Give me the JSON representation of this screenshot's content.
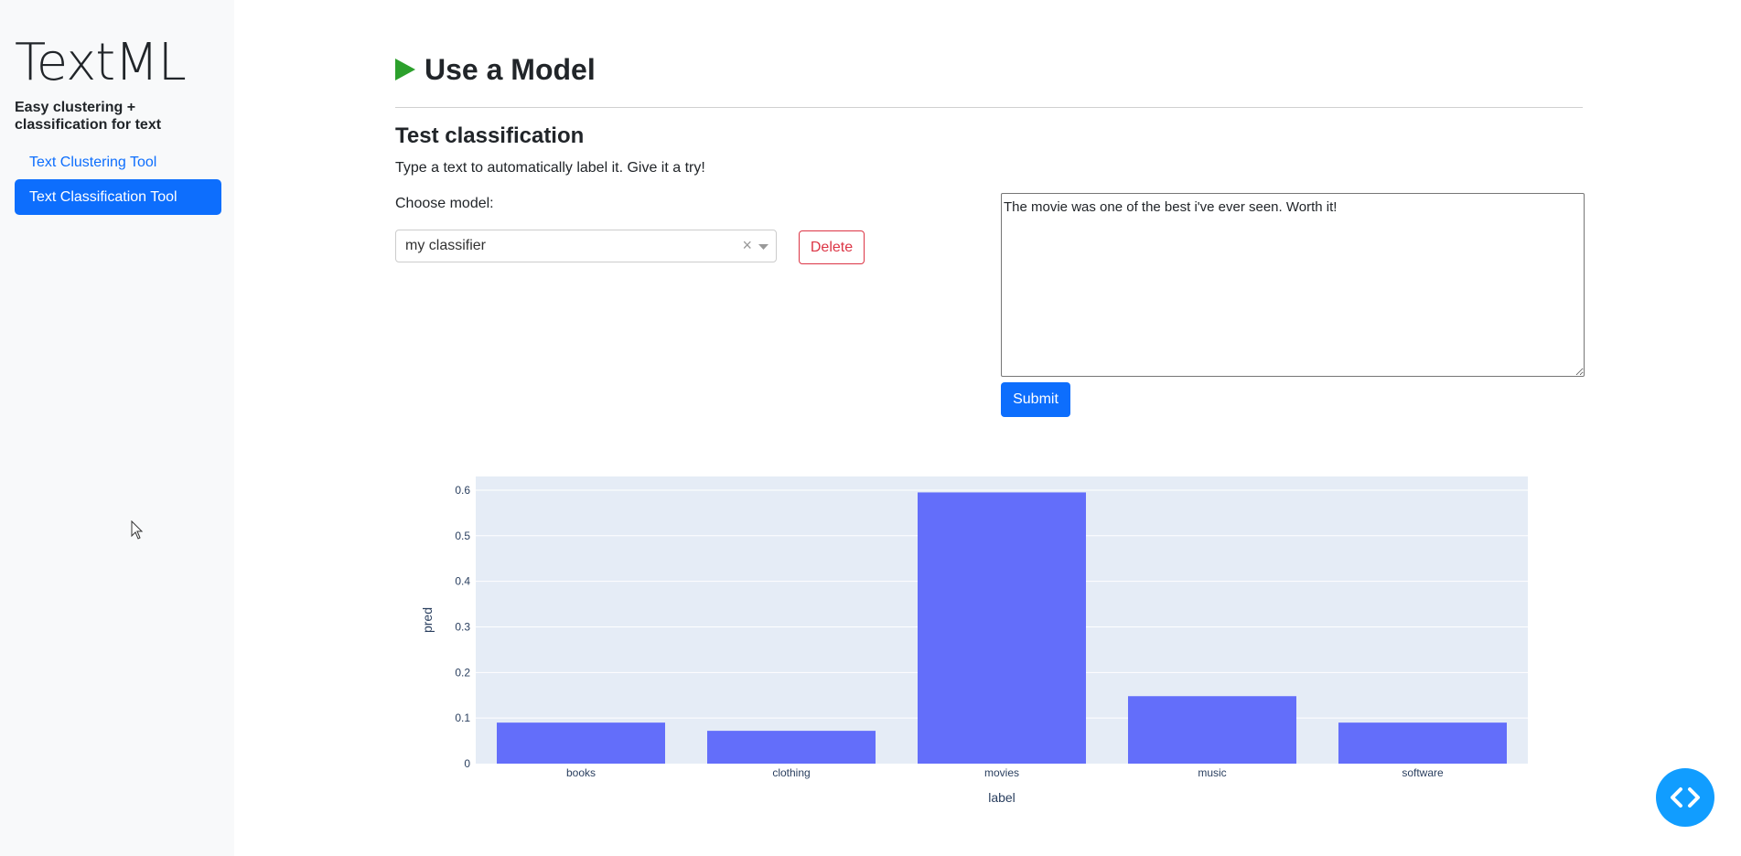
{
  "sidebar": {
    "brand": "TextML",
    "tagline": "Easy clustering + classification for text",
    "nav": [
      {
        "label": "Text Clustering Tool",
        "active": false
      },
      {
        "label": "Text Classification Tool",
        "active": true
      }
    ]
  },
  "main": {
    "title": "Use a Model",
    "subtitle": "Test classification",
    "hint": "Type a text to automatically label it. Give it a try!",
    "model_label": "Choose model:",
    "model_selected": "my classifier",
    "delete_label": "Delete",
    "text_value": "The movie was one of the best i've ever seen. Worth it!",
    "submit_label": "Submit"
  },
  "colors": {
    "primary": "#0d6efd",
    "danger": "#dc3545",
    "play": "#2ca02c",
    "bar": "#636efa",
    "plot_bg": "#e5ecf6",
    "fab": "#119dff"
  },
  "icons": {
    "title": "play-icon",
    "clear": "clear-icon",
    "dropdown": "chevron-down-icon",
    "fab": "code-icon",
    "cursor": "mouse-pointer-icon"
  },
  "chart_data": {
    "type": "bar",
    "categories": [
      "books",
      "clothing",
      "movies",
      "music",
      "software"
    ],
    "values": [
      0.09,
      0.072,
      0.595,
      0.148,
      0.09
    ],
    "xlabel": "label",
    "ylabel": "pred",
    "ylim": [
      0,
      0.63
    ],
    "yticks": [
      "0",
      "0.1",
      "0.2",
      "0.3",
      "0.4",
      "0.5",
      "0.6"
    ],
    "grid": true
  }
}
